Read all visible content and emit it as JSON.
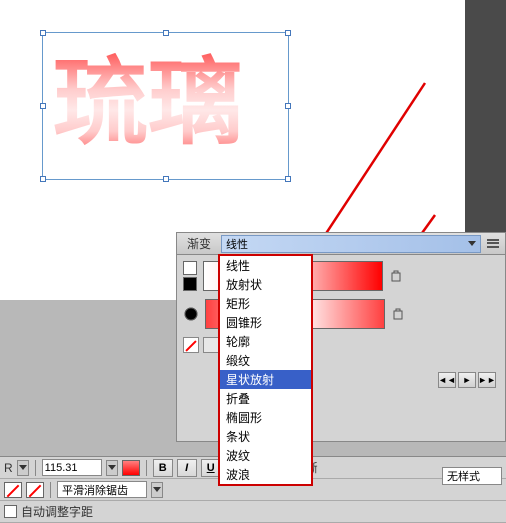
{
  "canvas": {
    "text": "琉璃"
  },
  "panel": {
    "title": "渐变",
    "dropdown_selected": "线性",
    "options": [
      "线性",
      "放射状",
      "矩形",
      "圆锥形",
      "轮廓",
      "缎纹",
      "星状放射",
      "折叠",
      "椭圆形",
      "条状",
      "波纹",
      "波浪"
    ],
    "selected_option": "星状放射"
  },
  "toolbar": {
    "font_label": "R",
    "size_value": "115.31",
    "bold": "B",
    "italic": "I",
    "underline": "U",
    "smooth_label": "平滑消除锯齿",
    "auto_kern_label": "自动调整字距",
    "style_label": "无样式",
    "gradient_short": "渐"
  },
  "timeline": {
    "prev": "◄◄",
    "play": "►",
    "next": "►►"
  }
}
